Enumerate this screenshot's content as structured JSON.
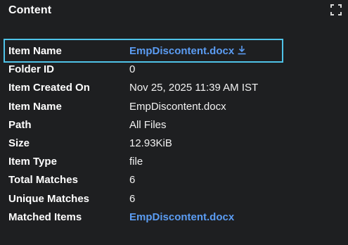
{
  "panel": {
    "title": "Content",
    "expand_icon": "expand-icon"
  },
  "rows": [
    {
      "label": "Item Name",
      "value": "EmpDiscontent.docx",
      "kind": "link-download"
    },
    {
      "label": "Folder ID",
      "value": "0",
      "kind": "text"
    },
    {
      "label": "Item Created On",
      "value": "Nov 25, 2025 11:39 AM IST",
      "kind": "text"
    },
    {
      "label": "Item Name",
      "value": "EmpDiscontent.docx",
      "kind": "text"
    },
    {
      "label": "Path",
      "value": "All Files",
      "kind": "text"
    },
    {
      "label": "Size",
      "value": "12.93KiB",
      "kind": "text"
    },
    {
      "label": "Item Type",
      "value": "file",
      "kind": "text"
    },
    {
      "label": "Total Matches",
      "value": "6",
      "kind": "text"
    },
    {
      "label": "Unique Matches",
      "value": "6",
      "kind": "text"
    },
    {
      "label": "Matched Items",
      "value": "EmpDiscontent.docx",
      "kind": "link"
    }
  ],
  "colors": {
    "background": "#1e1f21",
    "link": "#5b9cf2",
    "highlight": "#4fc3e8"
  }
}
